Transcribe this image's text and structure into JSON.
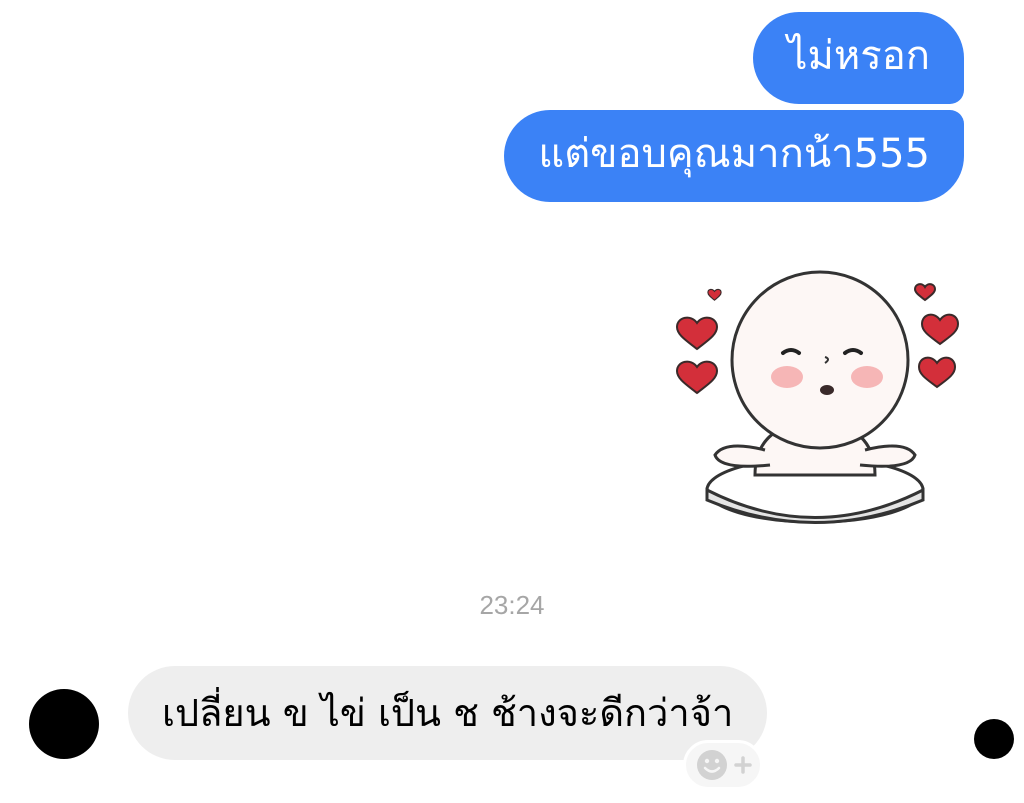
{
  "messages": {
    "outgoing": [
      {
        "text": "ไม่หรอก"
      },
      {
        "text": "แต่ขอบคุณมากน้า555"
      }
    ],
    "sticker": {
      "icon": "blushing-character-hearts-sticker"
    },
    "timestamp": "23:24",
    "incoming": [
      {
        "text": "เปลี่ยน ข ไข่ เป็น ช ช้างจะดีกว่าจ้า"
      }
    ]
  },
  "reaction_button": {
    "icon": "smiley-plus-icon"
  },
  "colors": {
    "outgoing_bubble": "#3b82f6",
    "incoming_bubble": "#eeeeee",
    "timestamp": "#a6a6a6",
    "heart": "#d32f3a"
  }
}
